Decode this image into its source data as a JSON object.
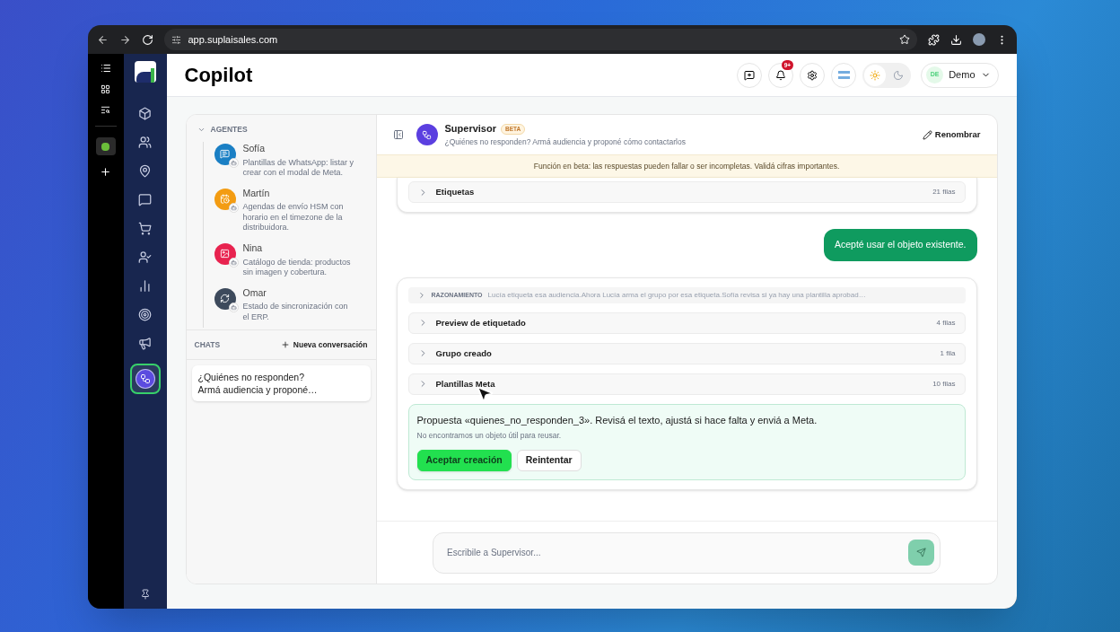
{
  "browser": {
    "url": "app.suplaisales.com"
  },
  "nav": {
    "items": [
      {
        "selected": false
      },
      {
        "selected": false
      },
      {
        "selected": false
      },
      {
        "selected": false
      },
      {
        "selected": false
      },
      {
        "selected": false
      },
      {
        "selected": false
      },
      {
        "selected": false
      },
      {
        "selected": false
      },
      {
        "selected": true
      }
    ]
  },
  "header": {
    "title": "Copilot",
    "notification_badge": "9+",
    "dark_mode": false,
    "user": {
      "initials": "DE",
      "name": "Demo"
    }
  },
  "agents": {
    "label": "AGENTES",
    "expanded": true,
    "items": [
      {
        "name": "Sofía",
        "description": "Plantillas de WhatsApp: listar y crear con el modal de Meta.",
        "color": "#1a7fc4"
      },
      {
        "name": "Martín",
        "description": "Agendas de envío HSM con horario en el timezone de la distribuidora.",
        "color": "#f39c12"
      },
      {
        "name": "Nina",
        "description": "Catálogo de tienda: productos sin imagen y cobertura.",
        "color": "#e8234f"
      },
      {
        "name": "Omar",
        "description": "Estado de sincronización con el ERP.",
        "color": "#3d4a5c"
      }
    ]
  },
  "chats": {
    "label": "CHATS",
    "new_button": "Nueva conversación",
    "items": [
      {
        "lines": [
          "¿Quiénes no responden?",
          "Armá audiencia y proponé…"
        ],
        "selected": true
      }
    ]
  },
  "conversation": {
    "title": "Supervisor",
    "badge": "BETA",
    "subtitle": "¿Quiénes no responden? Armá audiencia y proponé cómo contactarlos",
    "rename": "Renombrar",
    "banner": "Función en beta: las respuestas pueden fallar o ser incompletas. Validá cifras importantes."
  },
  "messages": [
    {
      "kind": "assistant",
      "sections": [
        {
          "title": "Etiquetas",
          "count": "21 filas",
          "expanded": false
        }
      ]
    },
    {
      "kind": "user",
      "text": "Acepté usar el objeto existente."
    },
    {
      "kind": "assistant",
      "reasoning": {
        "label": "RAZONAMIENTO",
        "text": "Lucía etiqueta esa audiencia.Ahora Lucía arma el grupo por esa etiqueta.Sofía revisa si ya hay una plantilla aprobad…"
      },
      "sections": [
        {
          "title": "Preview de etiquetado",
          "count": "4 filas",
          "expanded": false
        },
        {
          "title": "Grupo creado",
          "count": "1 fila",
          "expanded": false
        },
        {
          "title": "Plantillas Meta",
          "count": "10 filas",
          "expanded": false
        }
      ],
      "proposal": {
        "title": "Propuesta «quienes_no_responden_3». Revisá el texto, ajustá si hace falta y enviá a Meta.",
        "note": "No encontramos un objeto útil para reusar.",
        "buttons": [
          {
            "label": "Aceptar creación",
            "kind": "primary"
          },
          {
            "label": "Reintentar",
            "kind": "secondary"
          }
        ]
      }
    }
  ],
  "composer": {
    "placeholder": "Escribile a Supervisor..."
  }
}
